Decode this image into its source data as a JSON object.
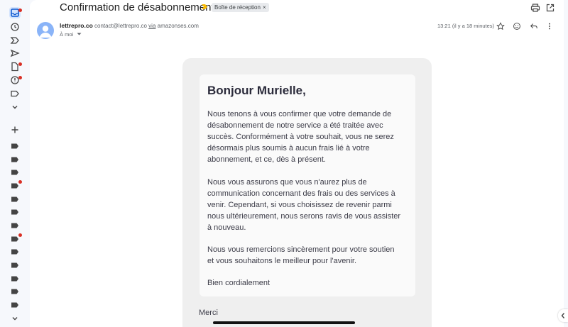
{
  "email": {
    "subject": "Confirmation de désabonnement",
    "label": "Boîte de réception",
    "label_close": "×",
    "sender_name": "lettrepro.co",
    "sender_email": "contact@lettrepro.co",
    "via_word": "via",
    "via_domain": "amazonses.com",
    "to": "À moi",
    "time": "13:21 (il y a 18 minutes)"
  },
  "body": {
    "greeting": "Bonjour Murielle,",
    "paragraph1": "Nous tenons à vous confirmer que votre demande de désabonnement de notre service a été traitée avec succès. Conformément à votre souhait, vous ne serez désormais plus soumis à aucun frais lié à votre abonnement, et ce, dès à présent.",
    "paragraph2": "Nous vous assurons que vous n'aurez plus de communication concernant des frais ou des services à venir. Cependant, si vous choisissez de revenir parmi nous ultérieurement, nous serons ravis de vous assister à nouveau.",
    "paragraph3": "Nous vous remercions sincèrement pour votre soutien et vous souhaitons le meilleur pour l'avenir.",
    "signoff": "Bien cordialement",
    "merci": "Merci"
  },
  "colors": {
    "accent": "#1a73e8",
    "badge": "#d93025",
    "importance": "#fbbc04"
  }
}
